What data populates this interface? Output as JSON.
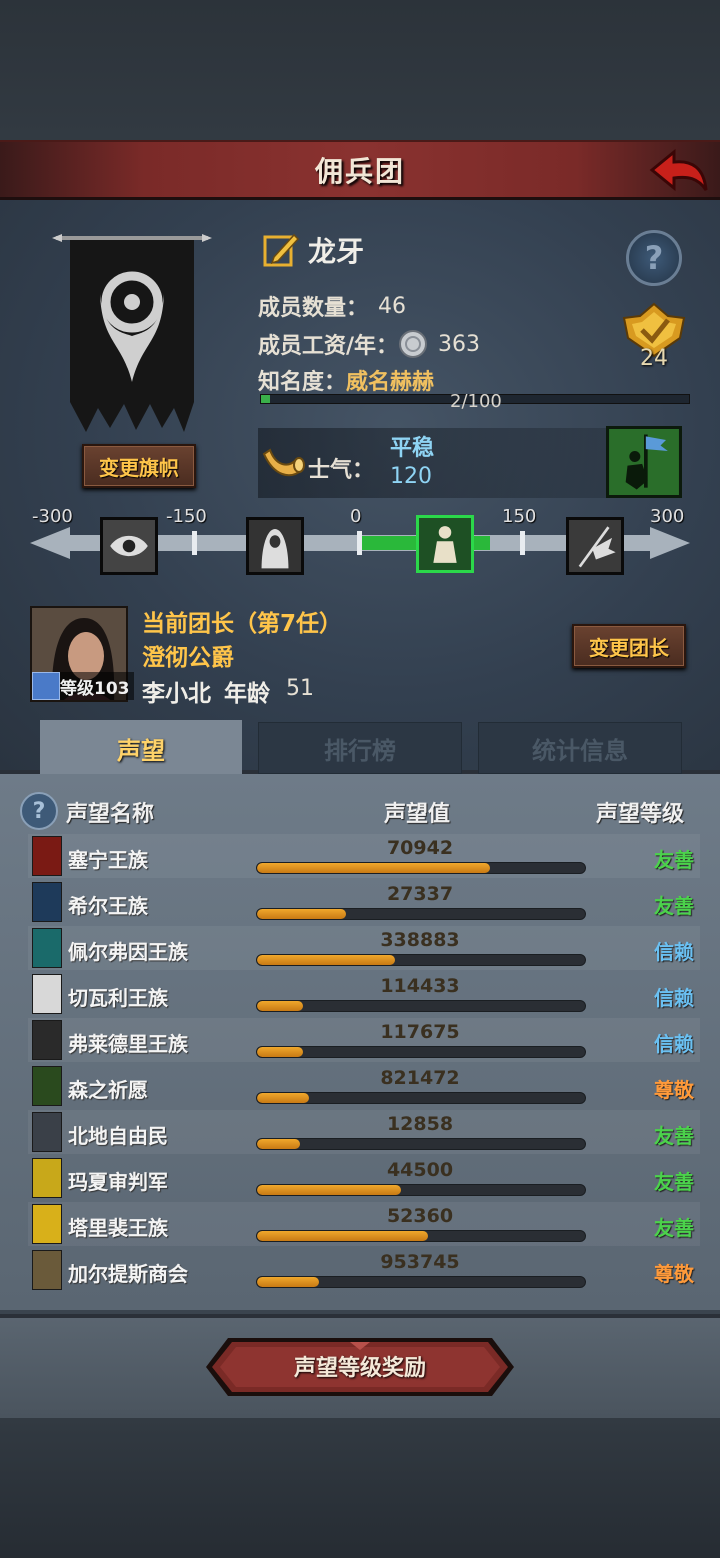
{
  "title": "佣兵团",
  "guild": {
    "name": "龙牙",
    "members_label": "成员数量：",
    "members_value": "46",
    "wage_label": "成员工资/年：",
    "wage_value": "363",
    "fame_label": "知名度：",
    "fame_value": "威名赫赫",
    "fame_progress": "2/100",
    "fame_fraction": 0.02,
    "badge_number": "24",
    "change_flag_label": "变更旗帜"
  },
  "morale": {
    "label": "士气：",
    "state": "平稳",
    "value": "120",
    "scale_ticks": [
      "-300",
      "-150",
      "0",
      "150",
      "300"
    ],
    "scale_icons": [
      "eye-icon",
      "hooded-figure-icon",
      "meditating-figure-icon",
      "tattered-flag-icon"
    ],
    "active_index": 2
  },
  "leader": {
    "title": "当前团长（第7任）",
    "rank": "澄彻公爵",
    "level": "等级103",
    "name": "李小北",
    "age_label": "年龄",
    "age": "51",
    "change_label": "变更团长"
  },
  "tabs": [
    {
      "label": "声望",
      "active": true
    },
    {
      "label": "排行榜",
      "active": false
    },
    {
      "label": "统计信息",
      "active": false
    }
  ],
  "reputation": {
    "headers": {
      "name": "声望名称",
      "value": "声望值",
      "level": "声望等级"
    },
    "rows": [
      {
        "name": "塞宁王族",
        "value": "70942",
        "fill": 0.71,
        "level": "友善",
        "level_class": "lv-friendly",
        "icon_color": "#7a1a14"
      },
      {
        "name": "希尔王族",
        "value": "27337",
        "fill": 0.27,
        "level": "友善",
        "level_class": "lv-friendly",
        "icon_color": "#1e3a5a"
      },
      {
        "name": "佩尔弗因王族",
        "value": "338883",
        "fill": 0.42,
        "level": "信赖",
        "level_class": "lv-trust",
        "icon_color": "#1a6a6a"
      },
      {
        "name": "切瓦利王族",
        "value": "114433",
        "fill": 0.14,
        "level": "信赖",
        "level_class": "lv-trust",
        "icon_color": "#d8d8d8"
      },
      {
        "name": "弗莱德里王族",
        "value": "117675",
        "fill": 0.14,
        "level": "信赖",
        "level_class": "lv-trust",
        "icon_color": "#2a2a2a"
      },
      {
        "name": "森之祈愿",
        "value": "821472",
        "fill": 0.16,
        "level": "尊敬",
        "level_class": "lv-respect",
        "icon_color": "#2a4a1e"
      },
      {
        "name": "北地自由民",
        "value": "12858",
        "fill": 0.13,
        "level": "友善",
        "level_class": "lv-friendly",
        "icon_color": "#3a4048"
      },
      {
        "name": "玛夏审判军",
        "value": "44500",
        "fill": 0.44,
        "level": "友善",
        "level_class": "lv-friendly",
        "icon_color": "#c8a81a"
      },
      {
        "name": "塔里裴王族",
        "value": "52360",
        "fill": 0.52,
        "level": "友善",
        "level_class": "lv-friendly",
        "icon_color": "#d8b01a"
      },
      {
        "name": "加尔提斯商会",
        "value": "953745",
        "fill": 0.19,
        "level": "尊敬",
        "level_class": "lv-respect",
        "icon_color": "#6a5a3a"
      }
    ]
  },
  "reward_button": "声望等级奖励"
}
